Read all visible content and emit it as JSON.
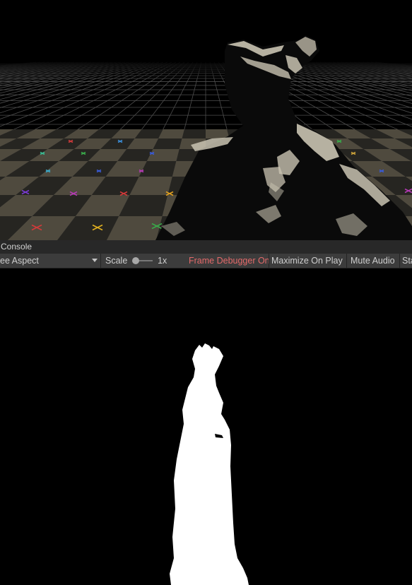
{
  "scene": {
    "grid_line_color": "#4d4d4d",
    "floor_light": "#4f4a3e",
    "floor_dark": "#262521",
    "statue_color": "#c9c3b1"
  },
  "tab_strip": {
    "console_label": "Console"
  },
  "toolbar": {
    "aspect_value": "ee Aspect",
    "scale_label": "Scale",
    "scale_value": "1x",
    "scale_fraction": 0.0,
    "frame_debugger_label": "Frame Debugger On",
    "frame_debugger_color": "#e46a6a",
    "maximize_label": "Maximize On Play",
    "mute_label": "Mute Audio",
    "stats_label": "Sta"
  },
  "game_view": {
    "background": "#000000",
    "mask_color": "#ffffff"
  }
}
